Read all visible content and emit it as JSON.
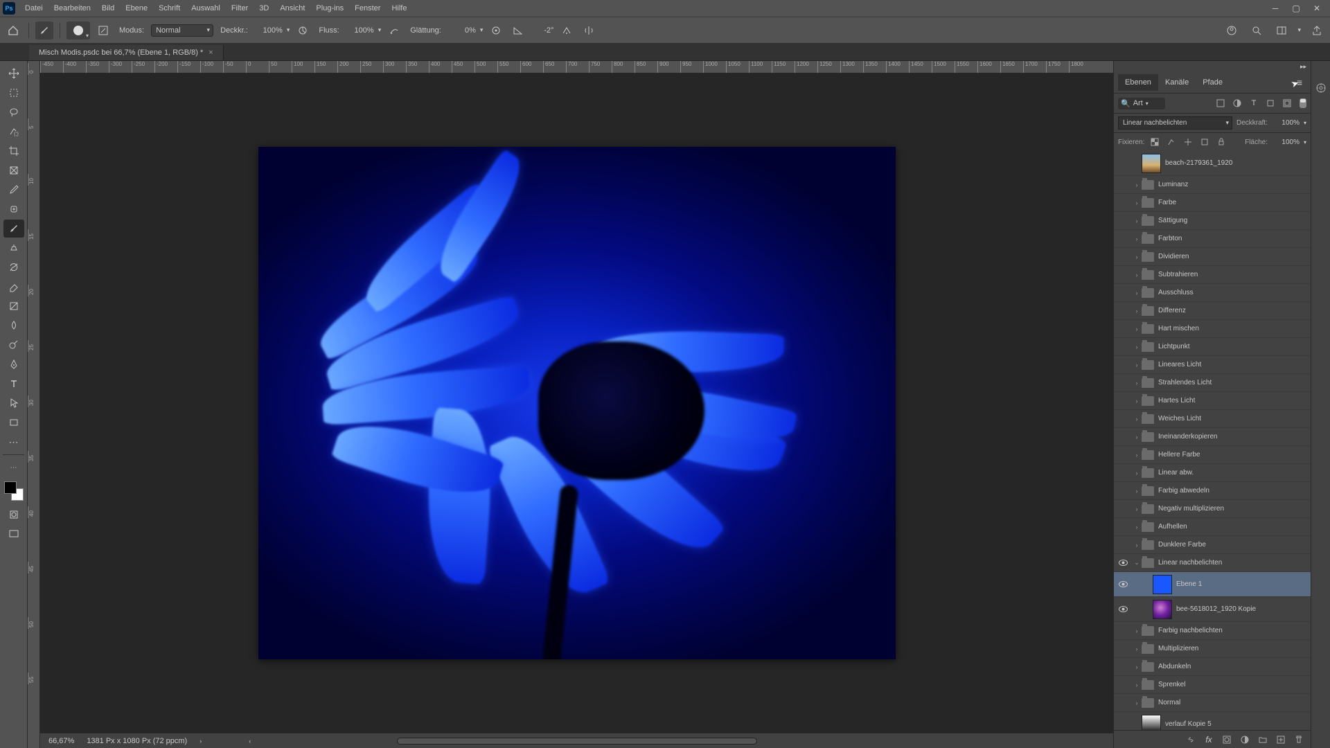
{
  "app_icon_text": "Ps",
  "menu": [
    "Datei",
    "Bearbeiten",
    "Bild",
    "Ebene",
    "Schrift",
    "Auswahl",
    "Filter",
    "3D",
    "Ansicht",
    "Plug-ins",
    "Fenster",
    "Hilfe"
  ],
  "options": {
    "mode_label": "Modus:",
    "mode_value": "Normal",
    "opacity_label": "Deckkr.:",
    "opacity_value": "100%",
    "flow_label": "Fluss:",
    "flow_value": "100%",
    "smoothing_label": "Glättung:",
    "smoothing_value": "0%",
    "angle_value": "-2°"
  },
  "document_tab": "Misch Modis.psdc bei 66,7% (Ebene 1, RGB/8) *",
  "ruler_h_ticks": [
    "-450",
    "-400",
    "-350",
    "-300",
    "-250",
    "-200",
    "-150",
    "-100",
    "-50",
    "0",
    "50",
    "100",
    "150",
    "200",
    "250",
    "300",
    "350",
    "400",
    "450",
    "500",
    "550",
    "600",
    "650",
    "700",
    "750",
    "800",
    "850",
    "900",
    "950",
    "1000",
    "1050",
    "1100",
    "1150",
    "1200",
    "1250",
    "1300",
    "1350",
    "1400",
    "1450",
    "1500",
    "1550",
    "1600",
    "1650",
    "1700",
    "1750",
    "1800"
  ],
  "ruler_v_ticks": [
    "0",
    "5",
    "10",
    "15",
    "20",
    "25",
    "30",
    "35",
    "40",
    "45",
    "50",
    "55"
  ],
  "status": {
    "zoom": "66,67%",
    "docinfo": "1381 Px x 1080 Px (72 ppcm)"
  },
  "panel_tabs": [
    "Ebenen",
    "Kanäle",
    "Pfade"
  ],
  "layer_search_label": "Art",
  "blend_mode_value": "Linear nachbelichten",
  "opacity_panel_label": "Deckkraft:",
  "opacity_panel_value": "100%",
  "lock_label": "Fixieren:",
  "fill_label": "Fläche:",
  "fill_value": "100%",
  "layers": [
    {
      "kind": "img",
      "name": "beach-2179361_1920",
      "thumb": "img1",
      "visible": false,
      "indent": 0,
      "tall": true
    },
    {
      "kind": "folder",
      "name": "Luminanz",
      "visible": false,
      "indent": 0
    },
    {
      "kind": "folder",
      "name": "Farbe",
      "visible": false,
      "indent": 0
    },
    {
      "kind": "folder",
      "name": "Sättigung",
      "visible": false,
      "indent": 0
    },
    {
      "kind": "folder",
      "name": "Farbton",
      "visible": false,
      "indent": 0
    },
    {
      "kind": "folder",
      "name": "Dividieren",
      "visible": false,
      "indent": 0
    },
    {
      "kind": "folder",
      "name": "Subtrahieren",
      "visible": false,
      "indent": 0
    },
    {
      "kind": "folder",
      "name": "Ausschluss",
      "visible": false,
      "indent": 0
    },
    {
      "kind": "folder",
      "name": "Differenz",
      "visible": false,
      "indent": 0
    },
    {
      "kind": "folder",
      "name": "Hart mischen",
      "visible": false,
      "indent": 0
    },
    {
      "kind": "folder",
      "name": "Lichtpunkt",
      "visible": false,
      "indent": 0
    },
    {
      "kind": "folder",
      "name": "Lineares Licht",
      "visible": false,
      "indent": 0
    },
    {
      "kind": "folder",
      "name": "Strahlendes Licht",
      "visible": false,
      "indent": 0
    },
    {
      "kind": "folder",
      "name": "Hartes Licht",
      "visible": false,
      "indent": 0
    },
    {
      "kind": "folder",
      "name": "Weiches Licht",
      "visible": false,
      "indent": 0
    },
    {
      "kind": "folder",
      "name": "Ineinanderkopieren",
      "visible": false,
      "indent": 0
    },
    {
      "kind": "folder",
      "name": "Hellere Farbe",
      "visible": false,
      "indent": 0
    },
    {
      "kind": "folder",
      "name": "Linear abw.",
      "visible": false,
      "indent": 0
    },
    {
      "kind": "folder",
      "name": "Farbig abwedeln",
      "visible": false,
      "indent": 0
    },
    {
      "kind": "folder",
      "name": "Negativ multiplizieren",
      "visible": false,
      "indent": 0
    },
    {
      "kind": "folder",
      "name": "Aufhellen",
      "visible": false,
      "indent": 0
    },
    {
      "kind": "folder",
      "name": "Dunklere Farbe",
      "visible": false,
      "indent": 0
    },
    {
      "kind": "folder",
      "name": "Linear nachbelichten",
      "visible": true,
      "indent": 0,
      "open": true
    },
    {
      "kind": "img",
      "name": "Ebene 1",
      "thumb": "blue",
      "visible": true,
      "indent": 1,
      "selected": true,
      "tall": true
    },
    {
      "kind": "img",
      "name": "bee-5618012_1920 Kopie",
      "thumb": "bee",
      "visible": true,
      "indent": 1,
      "tall": true
    },
    {
      "kind": "folder",
      "name": "Farbig nachbelichten",
      "visible": false,
      "indent": 0
    },
    {
      "kind": "folder",
      "name": "Multiplizieren",
      "visible": false,
      "indent": 0
    },
    {
      "kind": "folder",
      "name": "Abdunkeln",
      "visible": false,
      "indent": 0
    },
    {
      "kind": "folder",
      "name": "Sprenkel",
      "visible": false,
      "indent": 0
    },
    {
      "kind": "folder",
      "name": "Normal",
      "visible": false,
      "indent": 0
    },
    {
      "kind": "img",
      "name": "verlauf Kopie 5",
      "thumb": "grad",
      "visible": false,
      "indent": 0,
      "tall": true
    }
  ]
}
